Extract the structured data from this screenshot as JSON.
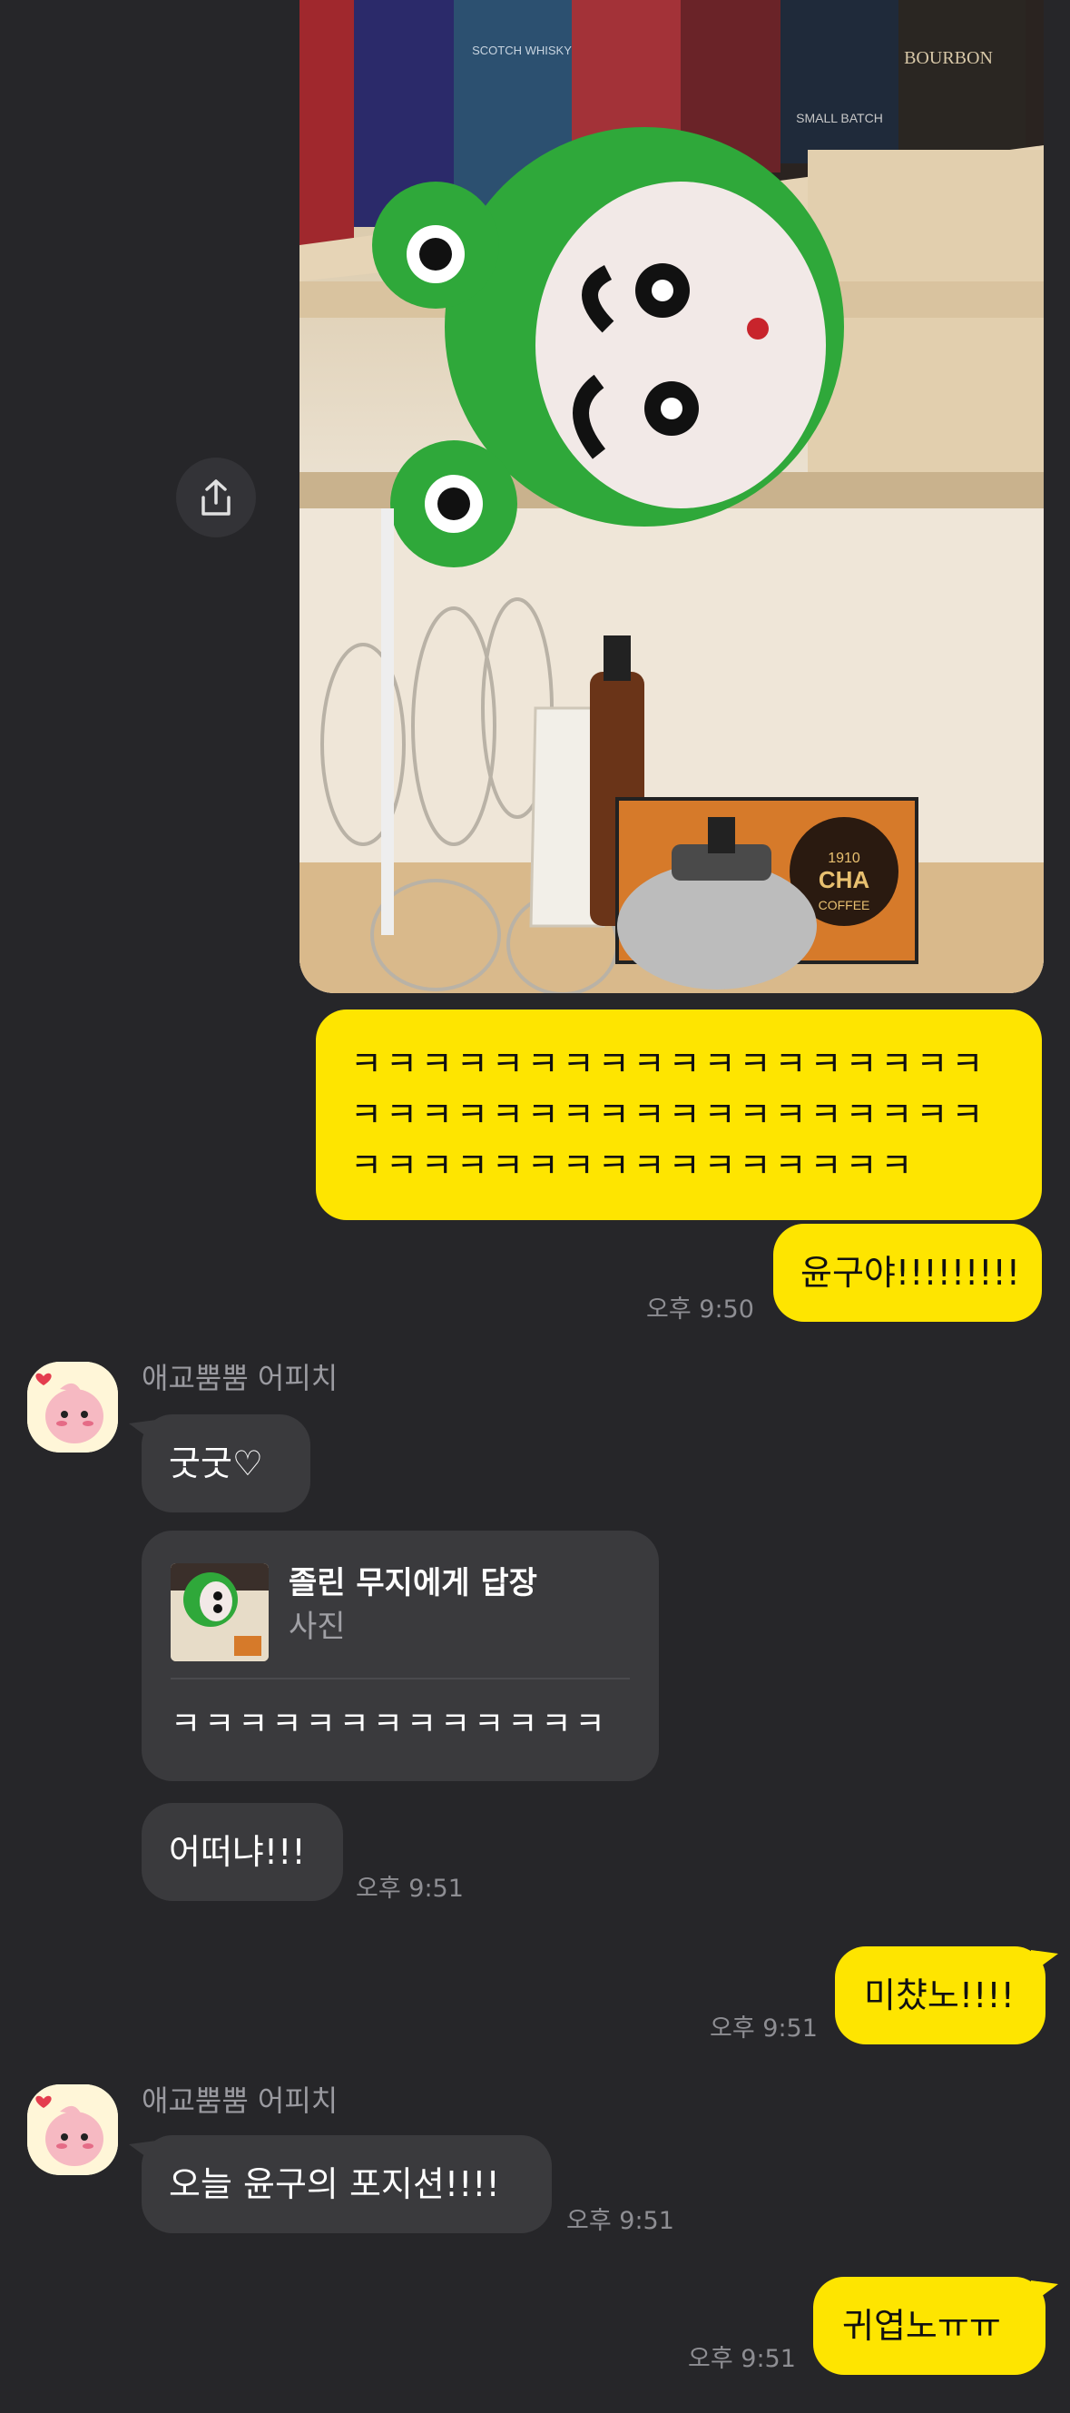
{
  "chat": {
    "sender_name": "애교뿜뿜 어피치",
    "messages": {
      "kk_long": "ㅋㅋㅋㅋㅋㅋㅋㅋㅋㅋㅋㅋㅋㅋㅋㅋㅋㅋㅋㅋㅋㅋㅋㅋㅋㅋㅋㅋㅋㅋㅋㅋㅋㅋㅋㅋㅋㅋㅋㅋㅋㅋㅋㅋㅋㅋㅋㅋㅋㅋㅋㅋ",
      "yungu": "윤구야!!!!!!!!!",
      "time_950": "오후 9:50",
      "goodgood": "굿굿♡",
      "reply_to": "졸린 무지에게 답장",
      "reply_type": "사진",
      "reply_text": "ㅋㅋㅋㅋㅋㅋㅋㅋㅋㅋㅋㅋㅋ",
      "how": "어떠냐!!!",
      "time_951a": "오후 9:51",
      "crazy": "미챴노!!!!",
      "time_951b": "오후 9:51",
      "today": "오늘 윤구의 포지션!!!!",
      "time_951c": "오후 9:51",
      "cute": "귀엽노ㅠㅠ",
      "time_951d": "오후 9:51"
    }
  },
  "photo": {
    "label_bourbon": "BOURBON",
    "label_scotch": "SCOTCH WHISKY",
    "label_small_batch": "SMALL BATCH",
    "label_cha": "CHA",
    "label_year": "1910",
    "label_coffee": "COFFEE"
  },
  "colors": {
    "background": "#262629",
    "my_bubble": "#FEE500",
    "their_bubble": "#3A3A3D",
    "time_text": "#8E8E93"
  },
  "icons": {
    "share": "share-icon",
    "avatar": "apeach-avatar"
  }
}
